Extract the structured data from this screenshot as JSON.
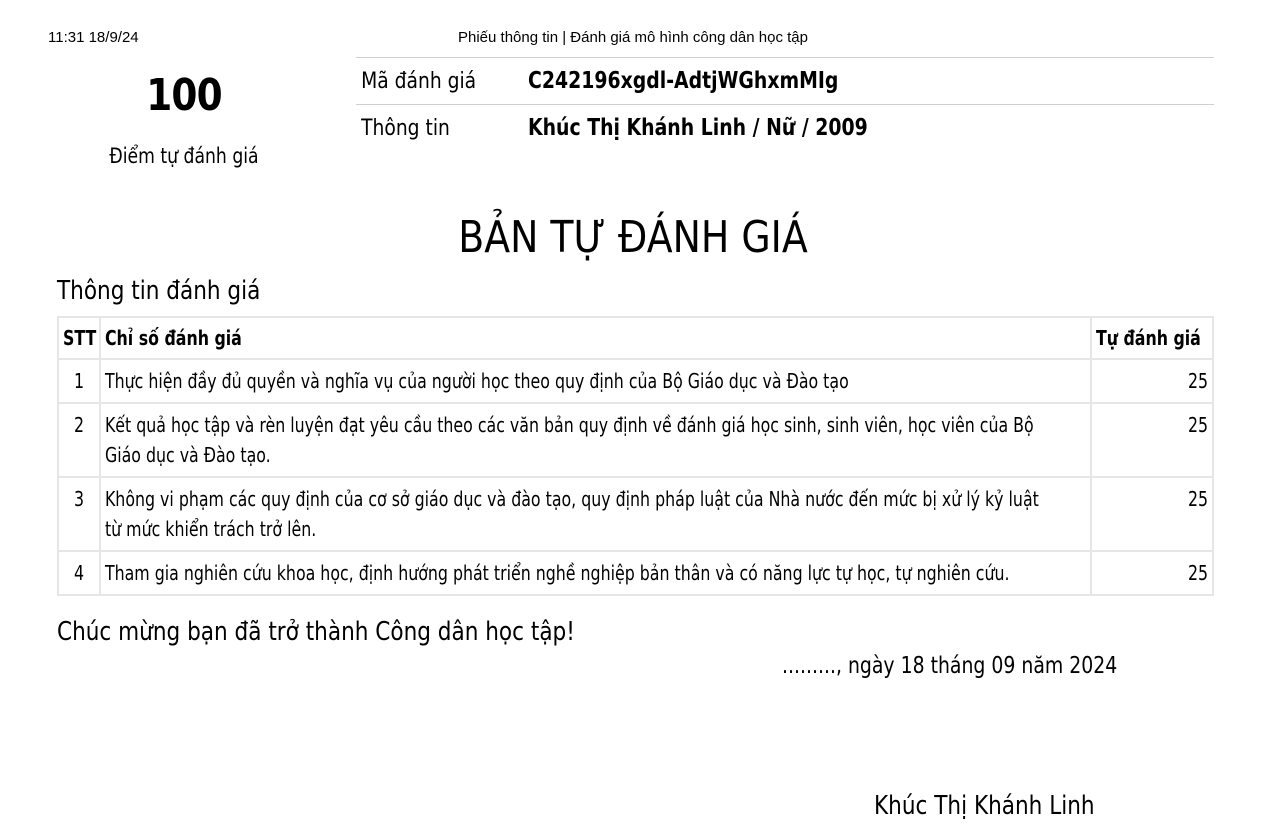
{
  "print_header": {
    "timestamp": "11:31 18/9/24",
    "title": "Phiếu thông tin | Đánh giá mô hình công dân học tập"
  },
  "score": {
    "value": "100",
    "label": "Điểm tự đánh giá"
  },
  "info": {
    "code_label": "Mã đánh giá",
    "code_value": "C242196xgdl-AdtjWGhxmMIg",
    "person_label": "Thông tin",
    "person_value": "Khúc Thị Khánh Linh / Nữ / 2009"
  },
  "document_title": "BẢN TỰ ĐÁNH GIÁ",
  "section_title": "Thông tin đánh giá",
  "table": {
    "headers": {
      "stt": "STT",
      "criterion": "Chỉ số đánh giá",
      "self_score": "Tự đánh giá"
    },
    "rows": [
      {
        "stt": "1",
        "criterion_lines": [
          "Thực hiện đầy đủ quyền và nghĩa vụ của người học theo quy định của Bộ Giáo dục và Đào tạo"
        ],
        "score": "25"
      },
      {
        "stt": "2",
        "criterion_lines": [
          "Kết quả học tập và rèn luyện đạt yêu cầu theo các văn bản quy định về đánh giá học sinh, sinh viên, học viên của Bộ",
          "Giáo dục và Đào tạo."
        ],
        "score": "25"
      },
      {
        "stt": "3",
        "criterion_lines": [
          "Không vi phạm các quy định của cơ sở giáo dục và đào tạo, quy định pháp luật của Nhà nước đến mức bị xử lý kỷ luật",
          "từ mức khiển trách trở lên."
        ],
        "score": "25"
      },
      {
        "stt": "4",
        "criterion_lines": [
          "Tham gia nghiên cứu khoa học, định hướng phát triển nghề nghiệp bản thân và có năng lực tự học, tự nghiên cứu."
        ],
        "score": "25"
      }
    ]
  },
  "congratulations": "Chúc mừng bạn đã trở thành Công dân học tập!",
  "date_line": "........., ngày 18 tháng 09 năm 2024",
  "signer_name": "Khúc Thị Khánh Linh",
  "colors": {
    "text": "#000000",
    "border": "#e6e6e6",
    "rule": "#cfcfcf",
    "background": "#ffffff"
  }
}
